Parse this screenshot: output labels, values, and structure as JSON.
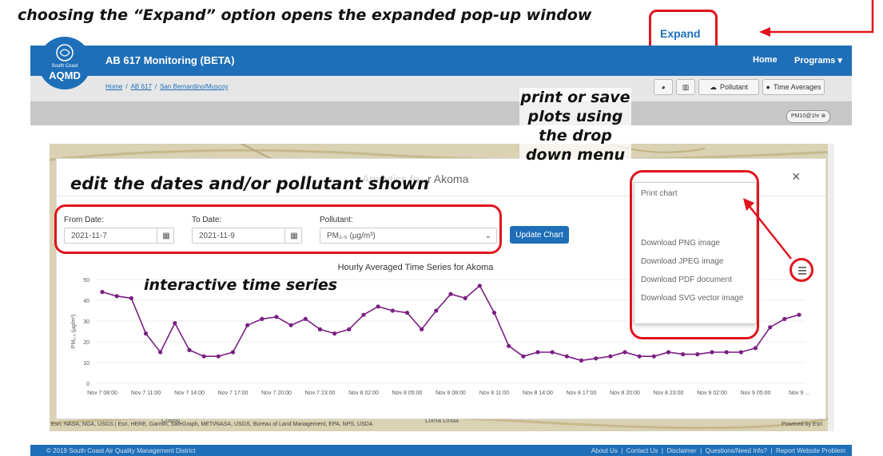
{
  "annotations": {
    "expand_note": "choosing the “Expand” option opens the expanded pop-up window",
    "expand_button": "Expand",
    "print_note": [
      "print or save",
      "plots using",
      "the drop",
      "down menu"
    ],
    "edit_note": "edit the dates and/or pollutant shown",
    "interactive_note": "interactive time series"
  },
  "header": {
    "logo_line1": "South Coast",
    "logo_line2": "AQMD",
    "title": "AB 617 Monitoring (BETA)",
    "nav": [
      "Home",
      "Programs ▾"
    ]
  },
  "breadcrumb": [
    "Home",
    "AB 617",
    "San Bernardino/Muscoy"
  ],
  "toolbar": {
    "pollutant": "Pollutant",
    "time_averages": "Time Averages",
    "chip": "PM10@1hr ⊗"
  },
  "modal": {
    "title_tail": "r Akoma",
    "title_faded": "Analytics fo",
    "close": "×",
    "from_label": "From Date:",
    "from_value": "2021-11-7",
    "to_label": "To Date:",
    "to_value": "2021-11-9",
    "pollutant_label": "Pollutant:",
    "pollutant_value": "PM₂.₅ (µg/m³)",
    "update_button": "Update Chart"
  },
  "export_menu": [
    "Print chart",
    "Download PNG image",
    "Download JPEG image",
    "Download PDF document",
    "Download SVG vector image"
  ],
  "map": {
    "attribution": "Esri, NASA, NGA, USGS | Esri, HERE, Garmin, SafeGraph, METI/NASA, USGS, Bureau of Land Management, EPA, NPS, USDA",
    "powered": "Powered by Esri",
    "place1": "Loma Linda",
    "place2": "Colton"
  },
  "footer": {
    "copyright": "© 2019 South Coast Air Quality Management District",
    "links": "About Us  |  Contact Us  |  Disclaimer  |  Questions/Need Info?  |  Report Website Problem"
  },
  "colors": {
    "line": "#7a1f82",
    "brand": "#1e6fb8",
    "annotation": "#e0141e"
  },
  "chart_data": {
    "type": "line",
    "title": "Hourly Averaged Time Series for Akoma",
    "ylabel": "PM₂.₅ (µg/m³)",
    "ylim": [
      0,
      50
    ],
    "yticks": [
      0,
      10,
      20,
      30,
      40,
      50
    ],
    "xtick_labels": [
      "Nov 7 08:00",
      "Nov 7 11:00",
      "Nov 7 14:00",
      "Nov 7 17:00",
      "Nov 7 20:00",
      "Nov 7 23:00",
      "Nov 8 02:00",
      "Nov 8 05:00",
      "Nov 8 08:00",
      "Nov 8 11:00",
      "Nov 8 14:00",
      "Nov 8 17:00",
      "Nov 8 20:00",
      "Nov 8 23:00",
      "Nov 9 02:00",
      "Nov 9 05:00",
      "Nov 9 ..."
    ],
    "series": [
      {
        "values": [
          44,
          42,
          41,
          24,
          15,
          29,
          16,
          13,
          13,
          15,
          28,
          31,
          32,
          28,
          31,
          26,
          24,
          26,
          33,
          37,
          35,
          34,
          26,
          35,
          43,
          41,
          47,
          34,
          18,
          13,
          15,
          15,
          13,
          11,
          12,
          13,
          15,
          13,
          13,
          15,
          14,
          14,
          15,
          15,
          15,
          17,
          27,
          31,
          33
        ]
      }
    ]
  }
}
